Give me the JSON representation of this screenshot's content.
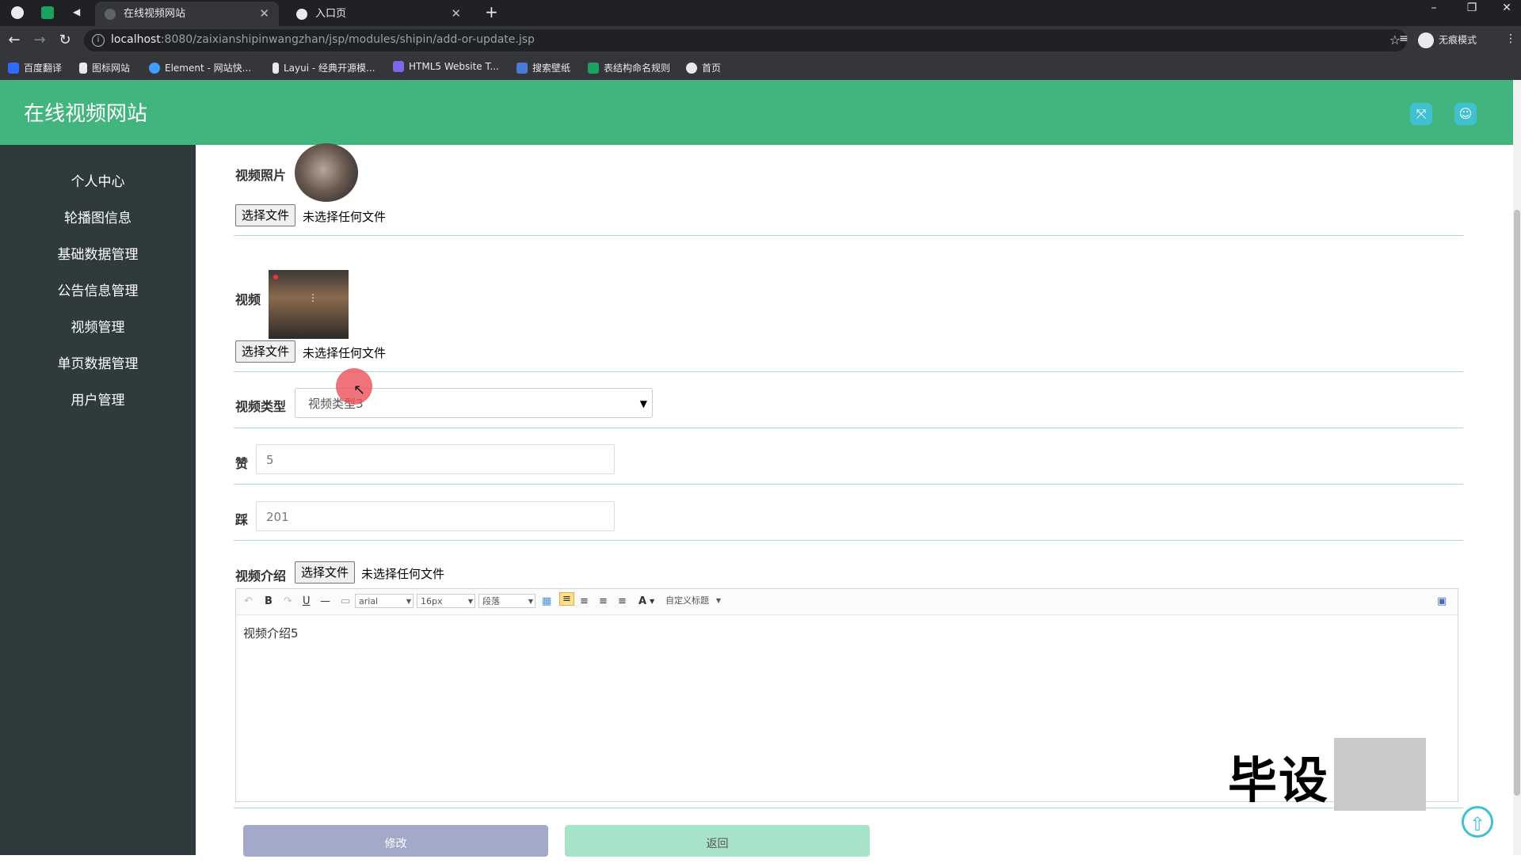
{
  "browser": {
    "tabs": [
      {
        "title": "在线视频网站",
        "active": true
      },
      {
        "title": "入口页",
        "active": false
      }
    ],
    "url_host": "localhost",
    "url_path": ":8080/zaixianshipinwangzhan/jsp/modules/shipin/add-or-update.jsp",
    "profile_label": "无痕模式",
    "bookmarks": [
      "百度翻译",
      "图标网站",
      "Element - 网站快...",
      "Layui - 经典开源模...",
      "HTML5 Website T...",
      "搜索壁纸",
      "表结构命名规则",
      "首页"
    ]
  },
  "app": {
    "title": "在线视频网站",
    "accent_color": "#41b57d",
    "sidebar_color": "#2f3a3d"
  },
  "sidebar": {
    "items": [
      "个人中心",
      "轮播图信息",
      "基础数据管理",
      "公告信息管理",
      "视频管理",
      "单页数据管理",
      "用户管理"
    ]
  },
  "form": {
    "photo_label": "视频照片",
    "video_label": "视频",
    "choose_file": "选择文件",
    "no_file": "未选择任何文件",
    "type_label": "视频类型",
    "type_value": "视频类型3",
    "like_label": "赞",
    "like_value": "5",
    "dislike_label": "踩",
    "dislike_value": "201",
    "intro_label": "视频介绍",
    "editor": {
      "font": "arial",
      "size": "16px",
      "paragraph": "段落",
      "custom_title": "自定义标题",
      "content": "视频介绍5"
    },
    "submit_label": "修改",
    "back_label": "返回"
  },
  "watermark": "毕设"
}
